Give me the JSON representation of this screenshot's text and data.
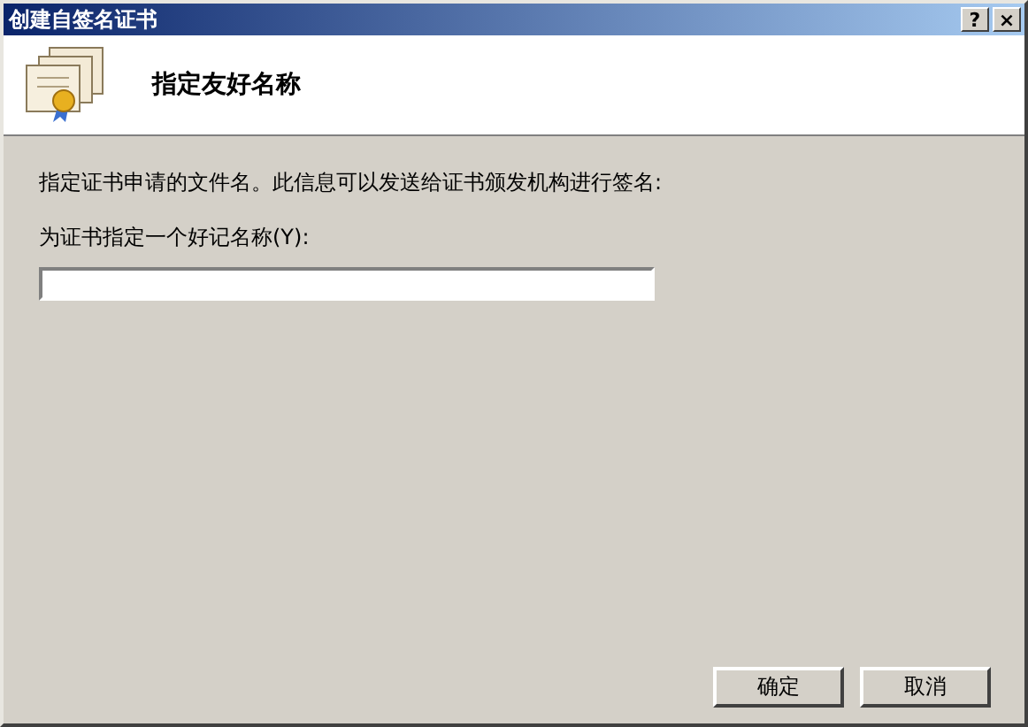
{
  "window": {
    "title": "创建自签名证书",
    "help_button": "?",
    "close_button": "×"
  },
  "header": {
    "title": "指定友好名称"
  },
  "body": {
    "description": "指定证书申请的文件名。此信息可以发送给证书颁发机构进行签名:",
    "field_label": "为证书指定一个好记名称(Y):"
  },
  "buttons": [
    {
      "label": "确定",
      "disabled": false
    },
    {
      "label": "取消",
      "disabled": false
    }
  ]
}
